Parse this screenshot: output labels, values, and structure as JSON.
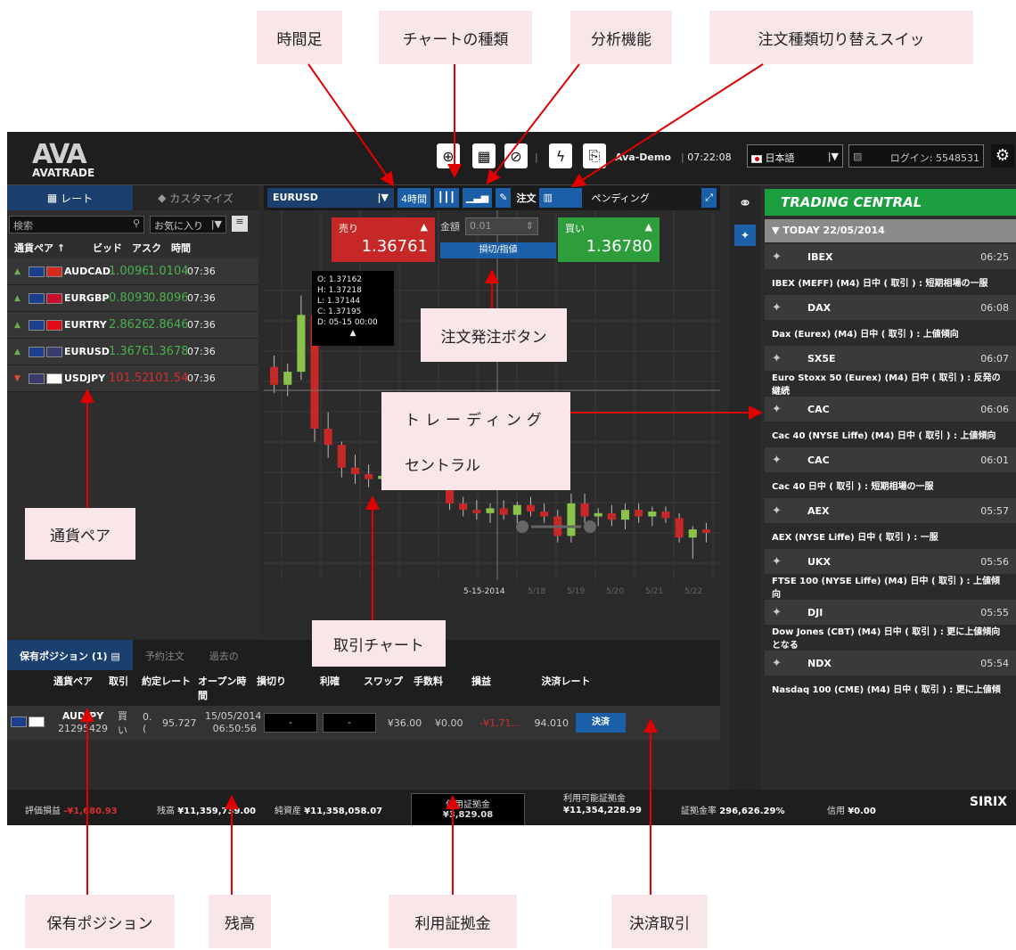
{
  "callouts": {
    "timeframe": "時間足",
    "chart_type": "チャートの種類",
    "analysis": "分析機能",
    "order_switch": "注文種類切り替えスイッ",
    "order_button": "注文発注ボタン",
    "trading_central_1": "トレーディング",
    "trading_central_2": "セントラル",
    "currency_pair": "通貨ペア",
    "trade_chart": "取引チャート",
    "positions": "保有ポジション",
    "balance": "残高",
    "used_margin": "利用証拠金",
    "settlement": "決済取引"
  },
  "topbar": {
    "logo_mark": "AVA",
    "logo_name": "AVATRADE",
    "account": "Ava-Demo",
    "time": "07:22:08",
    "language": "日本語",
    "login": "ログイン: 5548531"
  },
  "left": {
    "tab_rates": "レート",
    "tab_customize": "カスタマイズ",
    "search_placeholder": "検索",
    "favorites": "お気に入り",
    "col_pair": "通貨ペア ↑",
    "col_bid": "ビッド",
    "col_ask": "アスク",
    "col_time": "時間",
    "pairs": [
      {
        "dir": "▲",
        "name": "AUDCAD",
        "bid": "1.0096",
        "ask": "1.0104",
        "time": "07:36",
        "flag1": "#1b3f8e",
        "flag2": "#d52b1e"
      },
      {
        "dir": "▲",
        "name": "EURGBP",
        "bid": "0.8093",
        "ask": "0.8096",
        "time": "07:36",
        "flag1": "#1b3f8e",
        "flag2": "#c8102e"
      },
      {
        "dir": "▲",
        "name": "EURTRY",
        "bid": "2.8626",
        "ask": "2.8646",
        "time": "07:36",
        "flag1": "#1b3f8e",
        "flag2": "#e30a17"
      },
      {
        "dir": "▲",
        "name": "EURUSD",
        "bid": "1.3676",
        "ask": "1.3678",
        "time": "07:36",
        "flag1": "#1b3f8e",
        "flag2": "#3c3b6e"
      },
      {
        "dir": "▼",
        "name": "USDJPY",
        "bid": "101.52",
        "ask": "101.54",
        "time": "07:36",
        "flag1": "#3c3b6e",
        "flag2": "#ffffff"
      }
    ]
  },
  "center": {
    "symbol": "EURUSD",
    "timeframe": "4時間",
    "order_label": "注文",
    "pending": "ペンディング",
    "sell_label": "売り",
    "sell_price": "1.36761",
    "buy_label": "買い",
    "buy_price": "1.36780",
    "amount_label": "金額",
    "amount_value": "0.01",
    "sltp": "損切/指値",
    "ohlc_o": "O: 1.37162",
    "ohlc_h": "H: 1.37218",
    "ohlc_l": "L: 1.37144",
    "ohlc_c": "C: 1.37195",
    "ohlc_d": "D: 05-15 00:00",
    "x_label_date": "5-15-2014",
    "x_ticks": [
      "5/18",
      "5/19",
      "5/20",
      "5/21",
      "5/22"
    ]
  },
  "chart_data": {
    "type": "candlestick",
    "symbol": "EURUSD",
    "timeframe": "4時間",
    "candles": [
      {
        "o": 1.3768,
        "h": 1.3775,
        "l": 1.3752,
        "c": 1.3757
      },
      {
        "o": 1.3757,
        "h": 1.377,
        "l": 1.375,
        "c": 1.3765
      },
      {
        "o": 1.3765,
        "h": 1.3812,
        "l": 1.376,
        "c": 1.38
      },
      {
        "o": 1.38,
        "h": 1.3806,
        "l": 1.3722,
        "c": 1.373
      },
      {
        "o": 1.373,
        "h": 1.374,
        "l": 1.3712,
        "c": 1.372
      },
      {
        "o": 1.372,
        "h": 1.3722,
        "l": 1.37,
        "c": 1.3706
      },
      {
        "o": 1.3706,
        "h": 1.3714,
        "l": 1.3696,
        "c": 1.3702
      },
      {
        "o": 1.3702,
        "h": 1.3708,
        "l": 1.3694,
        "c": 1.3699
      },
      {
        "o": 1.3699,
        "h": 1.3704,
        "l": 1.3692,
        "c": 1.3701
      },
      {
        "o": 1.3701,
        "h": 1.3712,
        "l": 1.3698,
        "c": 1.3709
      },
      {
        "o": 1.3709,
        "h": 1.3716,
        "l": 1.37,
        "c": 1.3704
      },
      {
        "o": 1.3704,
        "h": 1.3713,
        "l": 1.37,
        "c": 1.3711
      },
      {
        "o": 1.3711,
        "h": 1.3712,
        "l": 1.3696,
        "c": 1.37
      },
      {
        "o": 1.37,
        "h": 1.3702,
        "l": 1.368,
        "c": 1.3684
      },
      {
        "o": 1.3684,
        "h": 1.3688,
        "l": 1.3676,
        "c": 1.368
      },
      {
        "o": 1.368,
        "h": 1.3686,
        "l": 1.3674,
        "c": 1.3678
      },
      {
        "o": 1.3678,
        "h": 1.3684,
        "l": 1.3672,
        "c": 1.3681
      },
      {
        "o": 1.3681,
        "h": 1.3686,
        "l": 1.3674,
        "c": 1.3677
      },
      {
        "o": 1.3677,
        "h": 1.3685,
        "l": 1.3672,
        "c": 1.3683
      },
      {
        "o": 1.3683,
        "h": 1.3688,
        "l": 1.3676,
        "c": 1.3679
      },
      {
        "o": 1.3679,
        "h": 1.3684,
        "l": 1.3672,
        "c": 1.3676
      },
      {
        "o": 1.3676,
        "h": 1.368,
        "l": 1.366,
        "c": 1.3664
      },
      {
        "o": 1.3664,
        "h": 1.369,
        "l": 1.366,
        "c": 1.3684
      },
      {
        "o": 1.3684,
        "h": 1.369,
        "l": 1.3672,
        "c": 1.3676
      },
      {
        "o": 1.3676,
        "h": 1.3681,
        "l": 1.367,
        "c": 1.3678
      },
      {
        "o": 1.3678,
        "h": 1.3683,
        "l": 1.367,
        "c": 1.3674
      },
      {
        "o": 1.3674,
        "h": 1.3684,
        "l": 1.3668,
        "c": 1.368
      },
      {
        "o": 1.368,
        "h": 1.3684,
        "l": 1.3672,
        "c": 1.3676
      },
      {
        "o": 1.3676,
        "h": 1.3682,
        "l": 1.367,
        "c": 1.3679
      },
      {
        "o": 1.3679,
        "h": 1.3682,
        "l": 1.3672,
        "c": 1.3675
      },
      {
        "o": 1.3675,
        "h": 1.3678,
        "l": 1.366,
        "c": 1.3663
      },
      {
        "o": 1.3663,
        "h": 1.367,
        "l": 1.365,
        "c": 1.3668
      },
      {
        "o": 1.3668,
        "h": 1.3672,
        "l": 1.366,
        "c": 1.3666
      }
    ],
    "ylim": [
      1.3645,
      1.3815
    ],
    "up_color": "#8bc34a",
    "down_color": "#c62828"
  },
  "right": {
    "title": "TRADING CENTRAL",
    "date": "TODAY 22/05/2014",
    "items": [
      {
        "sym": "IBEX",
        "time": "06:25",
        "text": "IBEX (MEFF) (M4) 日中 ( 取引 ) : 短期相場の一服"
      },
      {
        "sym": "DAX",
        "time": "06:08",
        "text": "Dax (Eurex) (M4) 日中 ( 取引 ) : 上値傾向"
      },
      {
        "sym": "SX5E",
        "time": "06:07",
        "text": "Euro Stoxx 50 (Eurex) (M4) 日中 ( 取引 ) : 反発の継続"
      },
      {
        "sym": "CAC",
        "time": "06:06",
        "text": "Cac 40 (NYSE Liffe) (M4) 日中 ( 取引 ) : 上値傾向"
      },
      {
        "sym": "CAC",
        "time": "06:01",
        "text": "Cac 40 日中 ( 取引 ) : 短期相場の一服"
      },
      {
        "sym": "AEX",
        "time": "05:57",
        "text": "AEX (NYSE Liffe) 日中 ( 取引 ) : 一服"
      },
      {
        "sym": "UKX",
        "time": "05:56",
        "text": "FTSE 100 (NYSE Liffe) (M4) 日中 ( 取引 ) : 上値傾向"
      },
      {
        "sym": "DJI",
        "time": "05:55",
        "text": "Dow Jones (CBT) (M4) 日中 ( 取引 ) : 更に上値傾向となる"
      },
      {
        "sym": "NDX",
        "time": "05:54",
        "text": "Nasdaq 100 (CME) (M4) 日中 ( 取引 ) : 更に上値傾"
      }
    ]
  },
  "bottom": {
    "tab_positions": "保有ポジション (1)",
    "tab_pending": "予約注文",
    "tab_history": "過去の",
    "cols": [
      "通貨ペア",
      "取引",
      "約定レート",
      "オープン時間",
      "損切り",
      "利確",
      "スワップ",
      "手数料",
      "損益",
      "決済レート"
    ],
    "row": {
      "pair": "AUDJPY",
      "id": "21295429",
      "side": "買い",
      "amount": "0.(",
      "rate": "95.727",
      "open_date": "15/05/2014",
      "open_time": "06:50:56",
      "sl": "-",
      "tp": "-",
      "swap": "¥36.00",
      "fee": "¥0.00",
      "pl": "-¥1,71...",
      "close_rate": "94.010",
      "close_btn": "決済"
    }
  },
  "footer": {
    "pl_label": "評価損益",
    "pl_value": "-¥1,680.93",
    "balance_label": "残高",
    "balance_value": "¥11,359,739.00",
    "equity_label": "純資産",
    "equity_value": "¥11,358,058.07",
    "used_label": "使用証拠金",
    "used_value": "¥3,829.08",
    "free_label": "利用可能証拠金",
    "free_value": "¥11,354,228.99",
    "ratio_label": "証拠金率",
    "ratio_value": "296,626.29%",
    "credit_label": "信用",
    "credit_value": "¥0.00",
    "brand": "SIRIX"
  }
}
